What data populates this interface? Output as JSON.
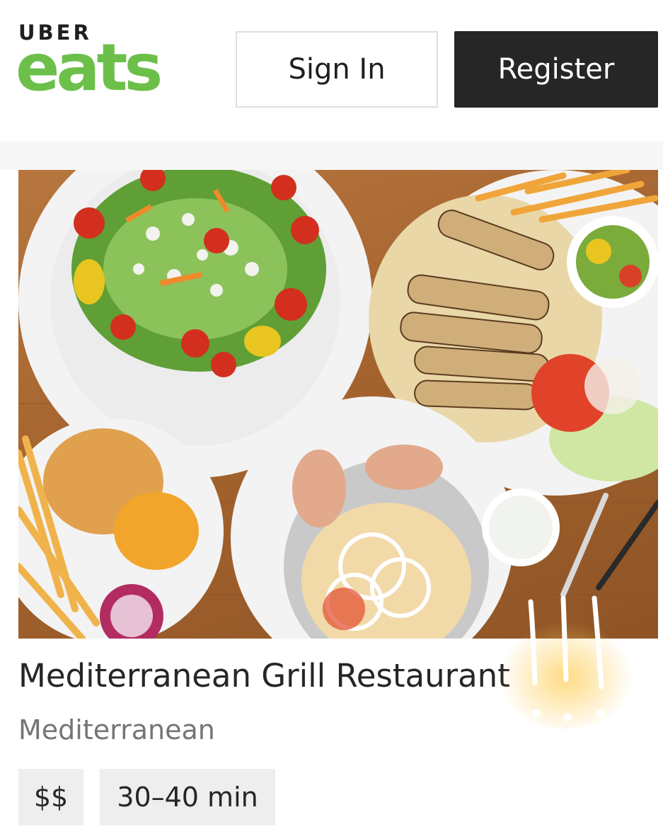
{
  "header": {
    "logo_line1": "UBER",
    "logo_line2": "eats",
    "sign_in_label": "Sign In",
    "register_label": "Register"
  },
  "restaurant": {
    "name": "Mediterranean Grill Restaurant",
    "cuisine": "Mediterranean",
    "price_range": "$$",
    "delivery_time": "30–40 min"
  },
  "colors": {
    "brand_green": "#6cc04a",
    "register_bg": "#262626",
    "badge_bg": "#eeeeee"
  },
  "icons": {
    "doodle": "exclamation-doodle-icon"
  }
}
